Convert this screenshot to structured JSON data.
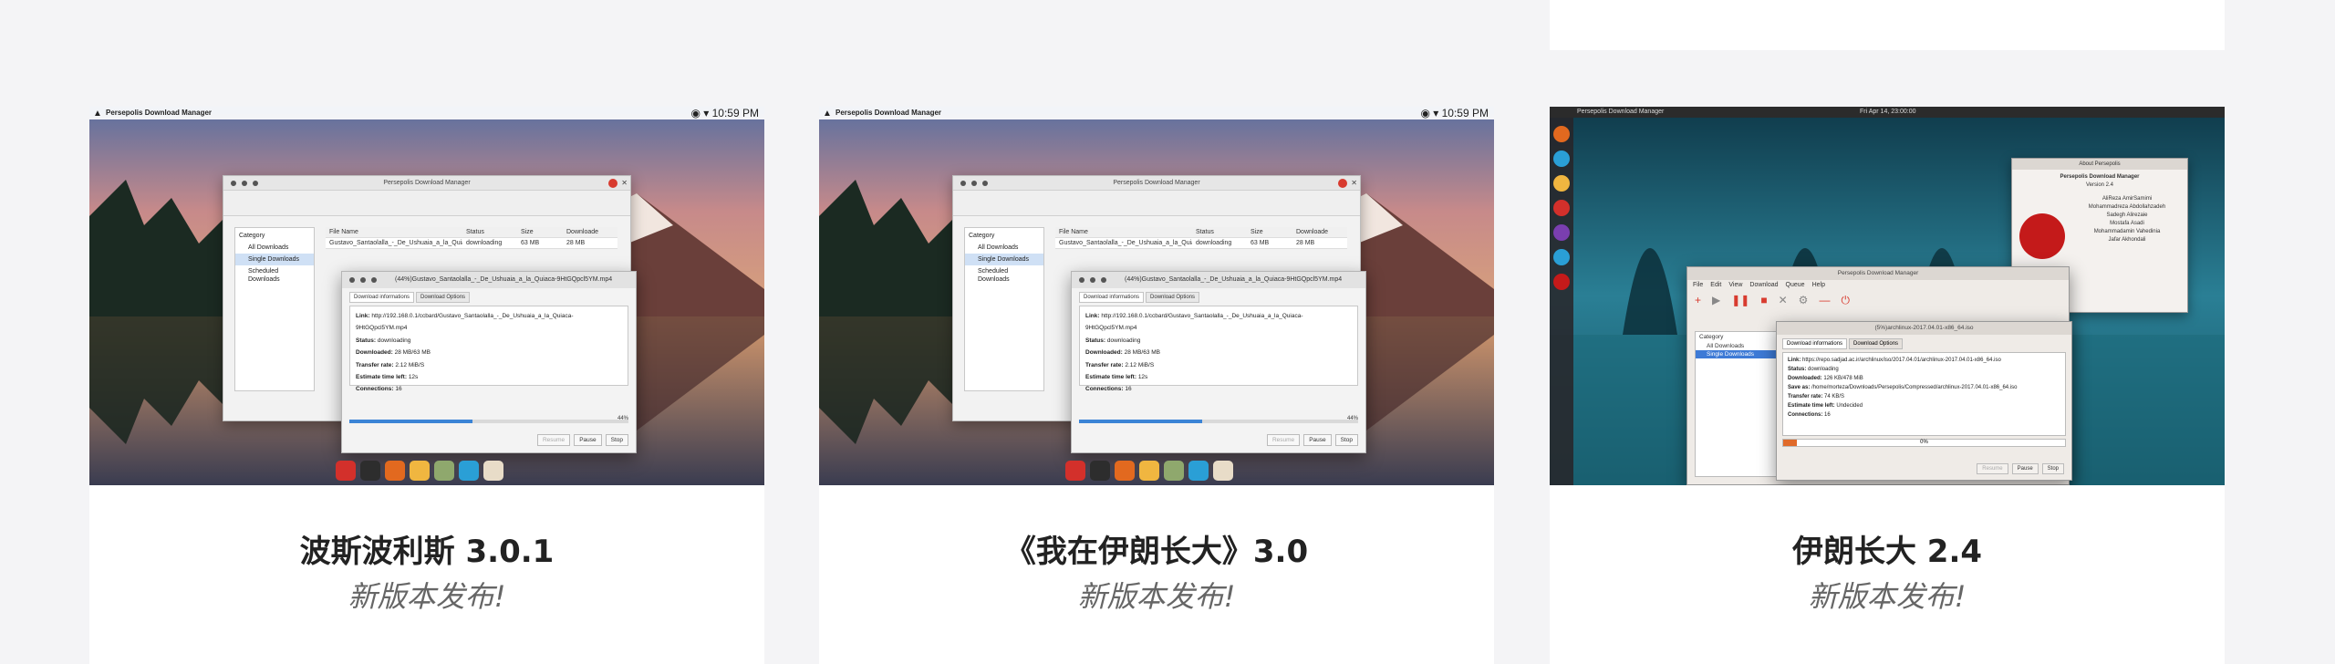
{
  "cards": [
    {
      "title": "波斯波利斯 3.0.1",
      "subtitle": "新版本发布!",
      "screenshot": {
        "menubar_app": "Persepolis Download Manager",
        "menubar_time": "10:59 PM",
        "main_window_title": "Persepolis Download Manager",
        "categories": [
          "Category",
          "All Downloads",
          "Single Downloads",
          "Scheduled Downloads"
        ],
        "table_headers": [
          "File Name",
          "Status",
          "Size",
          "Downloade"
        ],
        "table_row": [
          "Gustavo_Santaolalla_-_De_Ushuaia_a_la_Quiaca",
          "downloading",
          "63 MB",
          "28 MB"
        ],
        "dialog_title": "(44%)Gustavo_Santaolalla_-_De_Ushuaia_a_la_Quiaca-9HtGQpcl5YM.mp4",
        "tabs": [
          "Download informations",
          "Download Options"
        ],
        "link_label": "Link:",
        "link_value": "http://192.168.0.1/ccbard/Gustavo_Santaolalla_-_De_Ushuaia_a_la_Quiaca-9HtGQpcl5YM.mp4",
        "status_label": "Status:",
        "status_value": "downloading",
        "downloaded_label": "Downloaded:",
        "downloaded_value": "28 MB/63 MB",
        "rate_label": "Transfer rate:",
        "rate_value": "2.12 MiB/S",
        "eta_label": "Estimate time left:",
        "eta_value": "12s",
        "conn_label": "Connections:",
        "conn_value": "16",
        "progress": 0.44,
        "progress_text": "44%",
        "buttons": [
          "Resume",
          "Pause",
          "Stop"
        ]
      }
    },
    {
      "title": "《我在伊朗长大》3.0",
      "subtitle": "新版本发布!",
      "screenshot": {
        "menubar_app": "Persepolis Download Manager",
        "menubar_time": "10:59 PM",
        "main_window_title": "Persepolis Download Manager",
        "categories": [
          "Category",
          "All Downloads",
          "Single Downloads",
          "Scheduled Downloads"
        ],
        "table_headers": [
          "File Name",
          "Status",
          "Size",
          "Downloade"
        ],
        "table_row": [
          "Gustavo_Santaolalla_-_De_Ushuaia_a_la_Quiaca",
          "downloading",
          "63 MB",
          "28 MB"
        ],
        "dialog_title": "(44%)Gustavo_Santaolalla_-_De_Ushuaia_a_la_Quiaca-9HtGQpcl5YM.mp4",
        "tabs": [
          "Download informations",
          "Download Options"
        ],
        "link_label": "Link:",
        "link_value": "http://192.168.0.1/ccbard/Gustavo_Santaolalla_-_De_Ushuaia_a_la_Quiaca-9HtGQpcl5YM.mp4",
        "status_label": "Status:",
        "status_value": "downloading",
        "downloaded_label": "Downloaded:",
        "downloaded_value": "28 MB/63 MB",
        "rate_label": "Transfer rate:",
        "rate_value": "2.12 MiB/S",
        "eta_label": "Estimate time left:",
        "eta_value": "12s",
        "conn_label": "Connections:",
        "conn_value": "16",
        "progress": 0.44,
        "progress_text": "44%",
        "buttons": [
          "Resume",
          "Pause",
          "Stop"
        ]
      }
    },
    {
      "title": "伊朗长大 2.4",
      "subtitle": "新版本发布!",
      "screenshot": {
        "topbar_app": "Persepolis Download Manager",
        "clock": "Fri Apr 14, 23:00:00",
        "about_title": "About Persepolis",
        "about_name": "Persepolis Download Manager",
        "about_version": "Version 2.4",
        "about_credits": [
          "AliReza AmirSamimi",
          "Mohammadreza Abdollahzadeh",
          "Sadegh Alirezaie",
          "Mostafa Asadi",
          "Mohammadamin Vahedinia",
          "Jafar Akhondali"
        ],
        "main_title": "Persepolis Download Manager",
        "menu": [
          "File",
          "Edit",
          "View",
          "Download",
          "Queue",
          "Help"
        ],
        "dialog_title": "(5%)archlinux-2017.04.01-x86_64.iso",
        "categories": [
          "Category",
          "All Downloads",
          "Single Downloads"
        ],
        "tabs": [
          "Download informations",
          "Download Options"
        ],
        "lines": [
          [
            "Link:",
            "https://repo.sadjad.ac.ir/archlinux/iso/2017.04.01/archlinux-2017.04.01-x86_64.iso"
          ],
          [
            "Status:",
            "downloading"
          ],
          [
            "Downloaded:",
            "126 KB/478 MiB"
          ],
          [
            "Save as:",
            "/home/morteza/Downloads/Persepolis/Compressed/archlinux-2017.04.01-x86_64.iso"
          ],
          [
            "Transfer rate:",
            "74 KB/S"
          ],
          [
            "Estimate time left:",
            "Undecided"
          ],
          [
            "Connections:",
            "16"
          ]
        ],
        "progress": 0.05,
        "progress_text": "0%",
        "buttons": [
          "Resume",
          "Pause",
          "Stop"
        ]
      }
    }
  ],
  "colors": {
    "page_bg": "#f4f4f6",
    "card_bg": "#ffffff",
    "title": "#222222",
    "subtitle": "#666666",
    "accent_red": "#d83b2f",
    "progress_blue": "#3b84d6"
  }
}
